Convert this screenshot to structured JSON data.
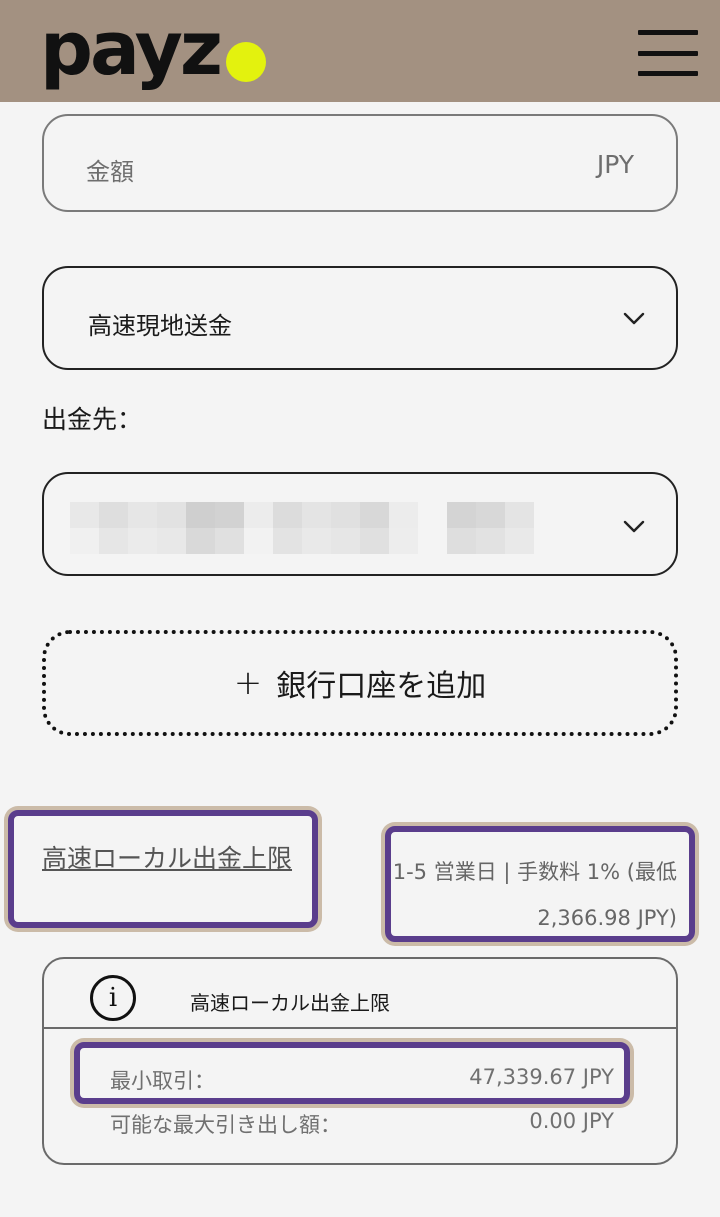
{
  "header": {
    "logo_text": "payz",
    "logo_dot_color": "#e3f20e",
    "bar_color": "#a39181",
    "menu_icon": "hamburger-menu-icon"
  },
  "form": {
    "amount_placeholder": "金額",
    "amount_currency": "JPY",
    "method_value": "高速現地送金",
    "destination_label": "出金先：",
    "add_bank_plus": "+",
    "add_bank_label": "銀行口座を追加"
  },
  "limits": {
    "link_label": "高速ローカル出金上限",
    "fee_line1": "1-5 営業日 | 手数料 1% (最低",
    "fee_line2": "2,366.98 JPY)",
    "panel_title": "高速ローカル出金上限",
    "info_icon_glyph": "i",
    "rows": [
      {
        "key": "最小取引：",
        "value": "47,339.67 JPY"
      },
      {
        "key": "可能な最大引き出し額：",
        "value": "0.00 JPY"
      }
    ]
  },
  "colors": {
    "highlight_border": "#5a3d8c",
    "highlight_glow": "#cbbba8"
  }
}
